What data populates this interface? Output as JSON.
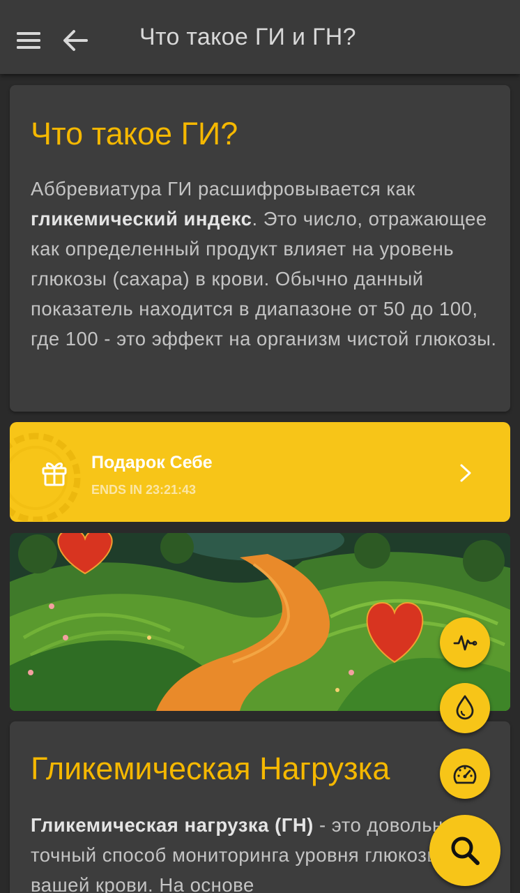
{
  "header": {
    "title": "Что такое ГИ и ГН?"
  },
  "gi_card": {
    "heading": "Что такое ГИ?",
    "p1": "Аббревиатура ГИ расшифровывается как ",
    "p1_bold": "гликемический индекс",
    "p1_rest": ". Это число, отражающее как определенный продукт влияет на уровень глюкозы (сахара) в крови. Обычно данный показатель находится в диапазоне от 50 до 100, где 100 - это эффект на организм чистой глюкозы."
  },
  "promo": {
    "title": "Подарок Себе",
    "timer": "ENDS IN 23:21:43"
  },
  "gn_card": {
    "heading": "Гликемическая Нагрузка",
    "p1_bold": "Гликемическая нагрузка (ГН)",
    "p1_rest": " - это довольно точный способ мониторинга уровня глюкозы в вашей крови. На основе"
  },
  "fabs": [
    "pulse-icon",
    "drop-icon",
    "gauge-icon",
    "search-icon"
  ],
  "colors": {
    "accent": "#f7c518",
    "heading": "#f5b800",
    "background": "#2a2a2a",
    "card": "#3d3d3d",
    "appbar": "#3a3a3a"
  }
}
